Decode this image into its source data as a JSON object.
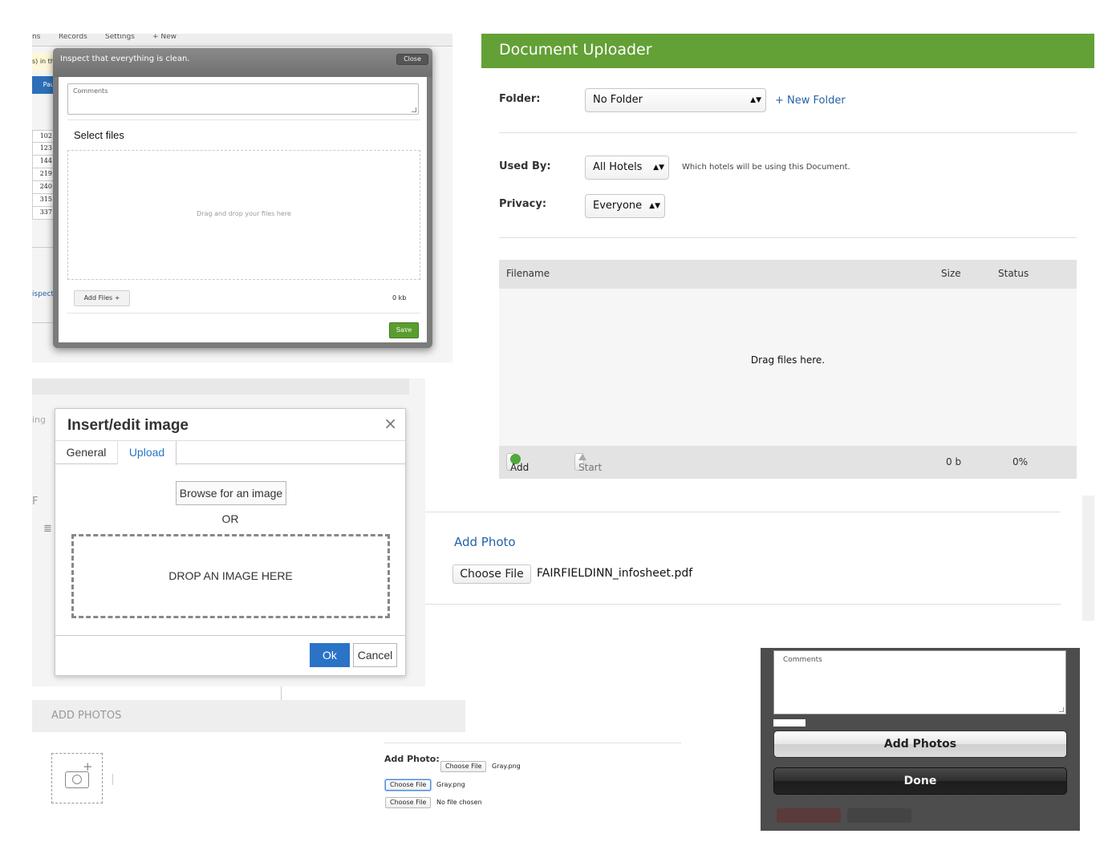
{
  "inspect_modal": {
    "bg_tabs": [
      "ns",
      "Records",
      "Settings",
      "+ New"
    ],
    "bg_notice": "s) in th",
    "bg_button": "Pau",
    "bg_numbers": [
      "102",
      "123",
      "144",
      "219",
      "240",
      "315",
      "337"
    ],
    "bg_link": "ispect",
    "title": "Inspect that everything is clean.",
    "close_label": "Close",
    "comments_placeholder": "Comments",
    "select_files_title": "Select files",
    "drop_text": "Drag and drop your files here",
    "add_files_label": "Add Files +",
    "size_total": "0 kb",
    "save_label": "Save"
  },
  "document_uploader": {
    "title": "Document Uploader",
    "folder_label": "Folder:",
    "folder_value": "No Folder",
    "new_folder_link": "+ New Folder",
    "used_by_label": "Used By:",
    "used_by_value": "All Hotels",
    "used_by_hint": "Which hotels will be using this Document.",
    "privacy_label": "Privacy:",
    "privacy_value": "Everyone",
    "columns": [
      "Filename",
      "Size",
      "Status"
    ],
    "drag_text": "Drag files here.",
    "add_files_label": "Add files",
    "start_upload_label": "Start upload",
    "total_size": "0 b",
    "total_status": "0%"
  },
  "insert_image": {
    "bg_text": "ing",
    "bg_text2": "F",
    "title": "Insert/edit image",
    "close_glyph": "×",
    "tabs": [
      {
        "label": "General"
      },
      {
        "label": "Upload",
        "active": true
      }
    ],
    "browse_label": "Browse for an image",
    "or_text": "OR",
    "drop_text": "DROP AN IMAGE HERE",
    "ok_label": "Ok",
    "cancel_label": "Cancel"
  },
  "add_photo": {
    "title": "Add Photo",
    "choose_file_label": "Choose File",
    "file_name": "FAIRFIELDINN_infosheet.pdf"
  },
  "add_photos_bar": {
    "title": "ADD PHOTOS",
    "icon": "camera-plus-icon"
  },
  "add_photo_small": {
    "label": "Add Photo:",
    "rows": [
      {
        "button": "Choose File",
        "file": "Gray.png"
      },
      {
        "button": "Choose File",
        "file": "Gray.png"
      },
      {
        "button": "Choose File",
        "file": "No file chosen"
      }
    ]
  },
  "mobile_panel": {
    "comments_placeholder": "Comments",
    "add_photos_label": "Add Photos",
    "done_label": "Done"
  },
  "colors": {
    "uploader_header": "#63a036",
    "save_green": "#5a9d2f",
    "link_blue": "#2462a8",
    "ok_blue": "#2a73c7",
    "mobile_bg": "#4d4d4d"
  }
}
